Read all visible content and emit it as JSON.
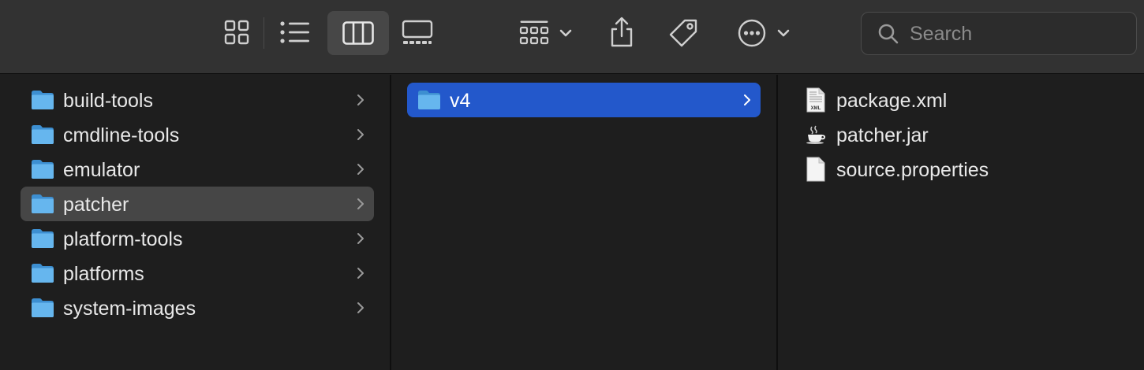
{
  "toolbar": {
    "view_buttons": [
      {
        "name": "icon-view",
        "icon": "grid-icon",
        "active": false
      },
      {
        "name": "list-view",
        "icon": "list-icon",
        "active": false
      },
      {
        "name": "column-view",
        "icon": "columns-icon",
        "active": true
      },
      {
        "name": "gallery-view",
        "icon": "gallery-icon",
        "active": false
      }
    ],
    "group_icon": "group-icon",
    "share_icon": "share-icon",
    "tag_icon": "tag-icon",
    "more_icon": "more-icon"
  },
  "search": {
    "placeholder": "Search",
    "value": ""
  },
  "columns": [
    {
      "items": [
        {
          "label": "build-tools",
          "type": "folder",
          "selected": false
        },
        {
          "label": "cmdline-tools",
          "type": "folder",
          "selected": false
        },
        {
          "label": "emulator",
          "type": "folder",
          "selected": false
        },
        {
          "label": "patcher",
          "type": "folder",
          "selected": true
        },
        {
          "label": "platform-tools",
          "type": "folder",
          "selected": false
        },
        {
          "label": "platforms",
          "type": "folder",
          "selected": false
        },
        {
          "label": "system-images",
          "type": "folder",
          "selected": false
        }
      ]
    },
    {
      "items": [
        {
          "label": "v4",
          "type": "folder",
          "selected": true
        }
      ]
    },
    {
      "items": [
        {
          "label": "package.xml",
          "type": "xml-file",
          "icon_text": "XML"
        },
        {
          "label": "patcher.jar",
          "type": "jar-file"
        },
        {
          "label": "source.properties",
          "type": "text-file"
        }
      ]
    }
  ],
  "colors": {
    "selection_active": "#2358cb",
    "selection_inactive": "#464646",
    "folder": "#5fb0ec"
  }
}
